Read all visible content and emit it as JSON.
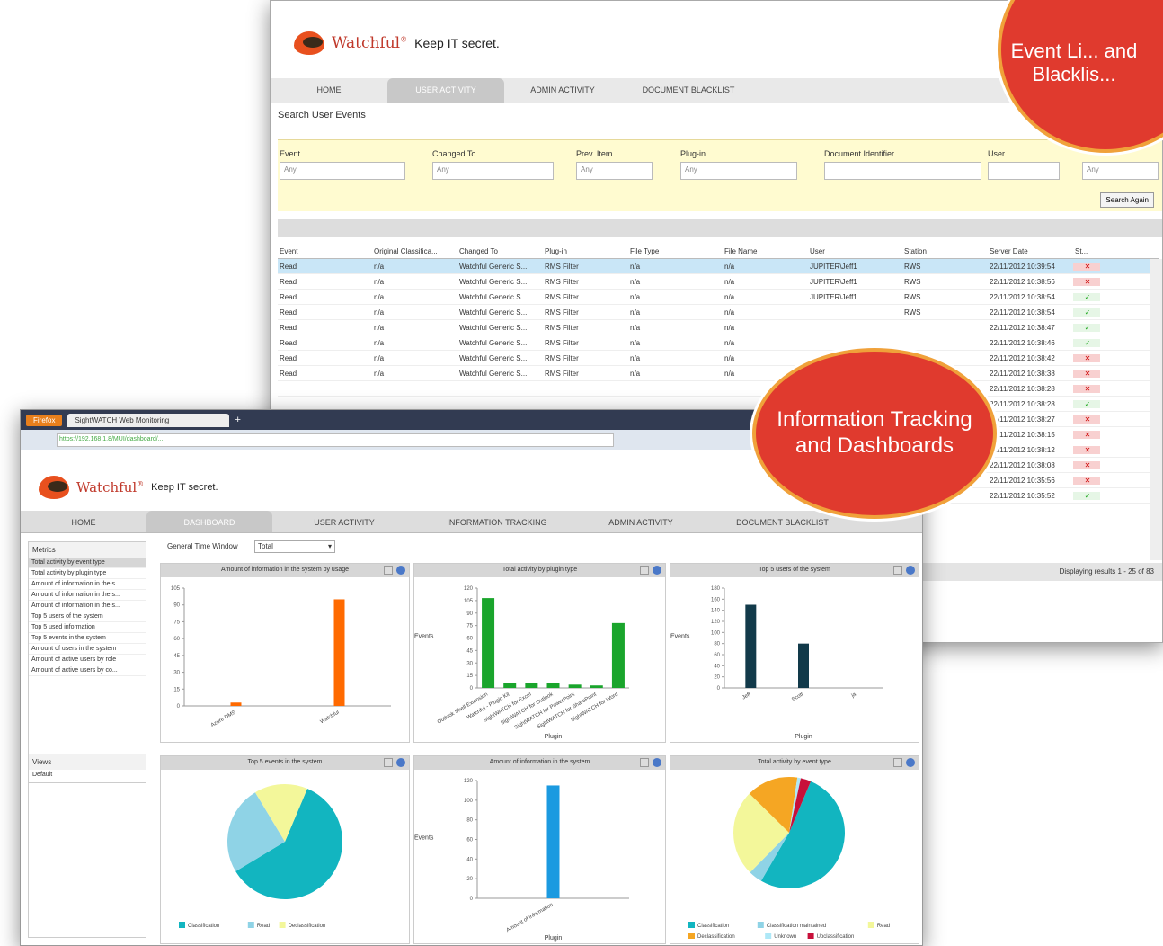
{
  "back": {
    "brand": "Watchful",
    "tagline": "Keep IT secret.",
    "tabs": [
      {
        "label": "HOME",
        "active": false
      },
      {
        "label": "USER ACTIVITY",
        "active": true
      },
      {
        "label": "ADMIN ACTIVITY",
        "active": false
      },
      {
        "label": "DOCUMENT BLACKLIST",
        "active": false
      }
    ],
    "section_title": "Search User Events",
    "filters": [
      {
        "label": "Event",
        "value": "Any"
      },
      {
        "label": "Changed To",
        "value": "Any"
      },
      {
        "label": "Prev. Item",
        "value": "Any"
      },
      {
        "label": "Plug-in",
        "value": "Any"
      },
      {
        "label": "Document Identifier",
        "value": ""
      },
      {
        "label": "User",
        "value": ""
      },
      {
        "label": "",
        "value": "Any"
      }
    ],
    "search_button": "Search Again",
    "columns": [
      "Event",
      "Original Classifica...",
      "Changed To",
      "Plug-in",
      "File Type",
      "File Name",
      "User",
      "Station",
      "Server Date",
      "St..."
    ],
    "rows": [
      {
        "event": "Read",
        "orig": "n/a",
        "changed": "Watchful Generic S...",
        "plugin": "RMS Filter",
        "ftype": "n/a",
        "fname": "n/a",
        "user": "JUPITER\\Jeff1",
        "station": "RWS",
        "date": "22/11/2012 10:39:54",
        "status": "x",
        "sel": true
      },
      {
        "event": "Read",
        "orig": "n/a",
        "changed": "Watchful Generic S...",
        "plugin": "RMS Filter",
        "ftype": "n/a",
        "fname": "n/a",
        "user": "JUPITER\\Jeff1",
        "station": "RWS",
        "date": "22/11/2012 10:38:56",
        "status": "x",
        "sel": false
      },
      {
        "event": "Read",
        "orig": "n/a",
        "changed": "Watchful Generic S...",
        "plugin": "RMS Filter",
        "ftype": "n/a",
        "fname": "n/a",
        "user": "JUPITER\\Jeff1",
        "station": "RWS",
        "date": "22/11/2012 10:38:54",
        "status": "ok",
        "sel": false
      },
      {
        "event": "Read",
        "orig": "n/a",
        "changed": "Watchful Generic S...",
        "plugin": "RMS Filter",
        "ftype": "n/a",
        "fname": "n/a",
        "user": "",
        "station": "RWS",
        "date": "22/11/2012 10:38:54",
        "status": "ok",
        "sel": false
      },
      {
        "event": "Read",
        "orig": "n/a",
        "changed": "Watchful Generic S...",
        "plugin": "RMS Filter",
        "ftype": "n/a",
        "fname": "n/a",
        "user": "",
        "station": "",
        "date": "22/11/2012 10:38:47",
        "status": "ok",
        "sel": false
      },
      {
        "event": "Read",
        "orig": "n/a",
        "changed": "Watchful Generic S...",
        "plugin": "RMS Filter",
        "ftype": "n/a",
        "fname": "n/a",
        "user": "",
        "station": "",
        "date": "22/11/2012 10:38:46",
        "status": "ok",
        "sel": false
      },
      {
        "event": "Read",
        "orig": "n/a",
        "changed": "Watchful Generic S...",
        "plugin": "RMS Filter",
        "ftype": "n/a",
        "fname": "n/a",
        "user": "",
        "station": "",
        "date": "22/11/2012 10:38:42",
        "status": "x",
        "sel": false
      },
      {
        "event": "Read",
        "orig": "n/a",
        "changed": "Watchful Generic S...",
        "plugin": "RMS Filter",
        "ftype": "n/a",
        "fname": "n/a",
        "user": "",
        "station": "",
        "date": "22/11/2012 10:38:38",
        "status": "x",
        "sel": false
      }
    ],
    "extra_rows": [
      {
        "date": "22/11/2012 10:38:28",
        "status": "x"
      },
      {
        "date": "22/11/2012 10:38:28",
        "status": "ok"
      },
      {
        "date": "22/11/2012 10:38:27",
        "status": "x"
      },
      {
        "date": "22/11/2012 10:38:15",
        "status": "x"
      },
      {
        "date": "22/11/2012 10:38:12",
        "status": "x"
      },
      {
        "date": "22/11/2012 10:38:08",
        "status": "x"
      },
      {
        "date": "22/11/2012 10:35:56",
        "status": "x"
      },
      {
        "date": "22/11/2012 10:35:52",
        "status": "ok"
      }
    ],
    "footer": "Displaying results 1 - 25 of 83"
  },
  "bubbles": {
    "top": "Event Li... and Blacklis...",
    "middle": "Information Tracking and Dashboards"
  },
  "front": {
    "browser_button": "Firefox",
    "browser_tab": "SightWATCH Web Monitoring",
    "url": "https://192.168.1.8/MUI/dashboard/...",
    "brand": "Watchful",
    "tagline": "Keep IT secret.",
    "tabs": [
      {
        "label": "HOME",
        "active": false
      },
      {
        "label": "DASHBOARD",
        "active": true
      },
      {
        "label": "USER ACTIVITY",
        "active": false
      },
      {
        "label": "INFORMATION TRACKING",
        "active": false
      },
      {
        "label": "ADMIN ACTIVITY",
        "active": false
      },
      {
        "label": "DOCUMENT BLACKLIST",
        "active": false
      }
    ],
    "menu_title": "Metrics",
    "menu_items": [
      "Total activity by event type",
      "Total activity by plugin type",
      "Amount of information in the s...",
      "Amount of information in the s...",
      "Amount of information in the s...",
      "Top 5 users of the system",
      "Top 5 used information",
      "Top 5 events in the system",
      "Amount of users in the system",
      "Amount of active users by role",
      "Amount of active users by co..."
    ],
    "views_title": "Views",
    "views_items": [
      "Default"
    ],
    "time_window_label": "General Time Window",
    "time_window_value": "Total",
    "panels": {
      "p1": "Amount of information in the system by usage",
      "p2": "Total activity by plugin type",
      "p3": "Top 5 users of the system",
      "p4": "Top 5 events in the system",
      "p5": "Amount of information in the system",
      "p6": "Total activity by event type"
    }
  },
  "colors": {
    "accent": "#e03a2e",
    "bubble_border": "#f0a13a",
    "orange": "#ff6a00",
    "green": "#1aa52c",
    "navy": "#123a4a",
    "blue": "#1b9ae0",
    "teal": "#12b5c0"
  },
  "chart_data": [
    {
      "type": "bar",
      "title": "Amount of information in the system by usage",
      "categories": [
        "Azure DMS",
        "Watchful"
      ],
      "values": [
        3,
        95
      ],
      "ylim": [
        0,
        105
      ],
      "yticks": [
        0,
        15,
        30,
        45,
        60,
        75,
        90,
        105
      ],
      "color": "#ff6a00"
    },
    {
      "type": "bar",
      "title": "Total activity by plugin type",
      "categories": [
        "Outlook Shell Extension",
        "Watchful - Plugin Kit",
        "SightWATCH for Excel",
        "SightWATCH for Outlook",
        "SightWATCH for PowerPoint",
        "SightWATCH for SharePoint",
        "SightWATCH for Word"
      ],
      "values": [
        108,
        6,
        6,
        6,
        4,
        3,
        78
      ],
      "ylim": [
        0,
        120
      ],
      "yticks": [
        0,
        15,
        30,
        45,
        60,
        75,
        90,
        105,
        120
      ],
      "ylabel": "Events",
      "xlabel": "Plugin",
      "color": "#1aa52c"
    },
    {
      "type": "bar",
      "title": "Top 5 users of the system",
      "categories": [
        "Jeff",
        "Scott",
        "ja"
      ],
      "values": [
        150,
        80,
        0
      ],
      "ylim": [
        0,
        180
      ],
      "yticks": [
        0,
        20,
        40,
        60,
        80,
        100,
        120,
        140,
        160,
        180
      ],
      "ylabel": "Events",
      "xlabel": "Plugin",
      "color": "#123a4a"
    },
    {
      "type": "pie",
      "title": "Top 5 events in the system",
      "labels": [
        "Classification",
        "Read",
        "Declassification"
      ],
      "values": [
        60,
        25,
        15
      ],
      "colors": [
        "#12b5c0",
        "#8fd3e6",
        "#f3f79a"
      ]
    },
    {
      "type": "bar",
      "title": "Amount of information in the system",
      "categories": [
        "Amount of information"
      ],
      "values": [
        115
      ],
      "ylim": [
        0,
        120
      ],
      "yticks": [
        0,
        20,
        40,
        60,
        80,
        100,
        120
      ],
      "ylabel": "Events",
      "xlabel": "Plugin",
      "color": "#1b9ae0"
    },
    {
      "type": "pie",
      "title": "Total activity by event type",
      "labels": [
        "Classification",
        "Classification maintained",
        "Read",
        "Declassification",
        "Unknown",
        "Upclassification"
      ],
      "values": [
        52,
        4,
        25,
        15,
        1,
        3
      ],
      "colors": [
        "#12b5c0",
        "#8fd3e6",
        "#f3f79a",
        "#f5a623",
        "#aee8f7",
        "#c8103a"
      ]
    }
  ]
}
